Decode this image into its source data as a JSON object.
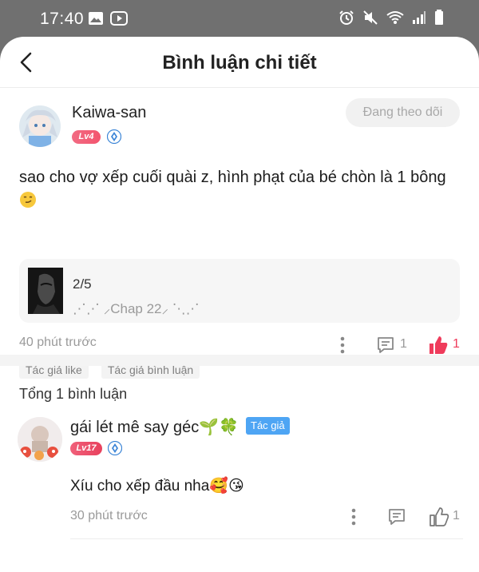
{
  "status_bar": {
    "time": "17:40",
    "icons": [
      "image-icon",
      "youtube-icon",
      "alarm-icon",
      "mute-icon",
      "wifi-icon",
      "signal-icon",
      "battery-icon"
    ]
  },
  "header": {
    "title": "Bình luận chi tiết"
  },
  "main_comment": {
    "username": "Kaiwa-san",
    "level": "Lv4",
    "follow_label": "Đang theo dõi",
    "text": "sao cho vợ xếp cuối quài z, hình phạt của bé chòn là 1 bông",
    "emoji": "😏",
    "reference": {
      "page": "2/5",
      "chapter": "⋰⋰ ⸝Chap 22⸝ ⋱⋰"
    },
    "time": "40 phút trước",
    "comment_count": "1",
    "like_count": "1",
    "tags": [
      "Tác giả like",
      "Tác giả bình luận"
    ]
  },
  "total_comments_label": "Tổng 1 bình luận",
  "reply": {
    "username": "gái lét mê say géc🌱🍀",
    "level": "Lv17",
    "author_badge": "Tác giả",
    "text": "Xíu cho xếp đầu nha🥰😘",
    "time": "30 phút trước",
    "like_count": "1"
  },
  "colors": {
    "accent_like": "#ef3b5b",
    "author_badge": "#4ea5f4",
    "level_badge": "#f2546e"
  }
}
